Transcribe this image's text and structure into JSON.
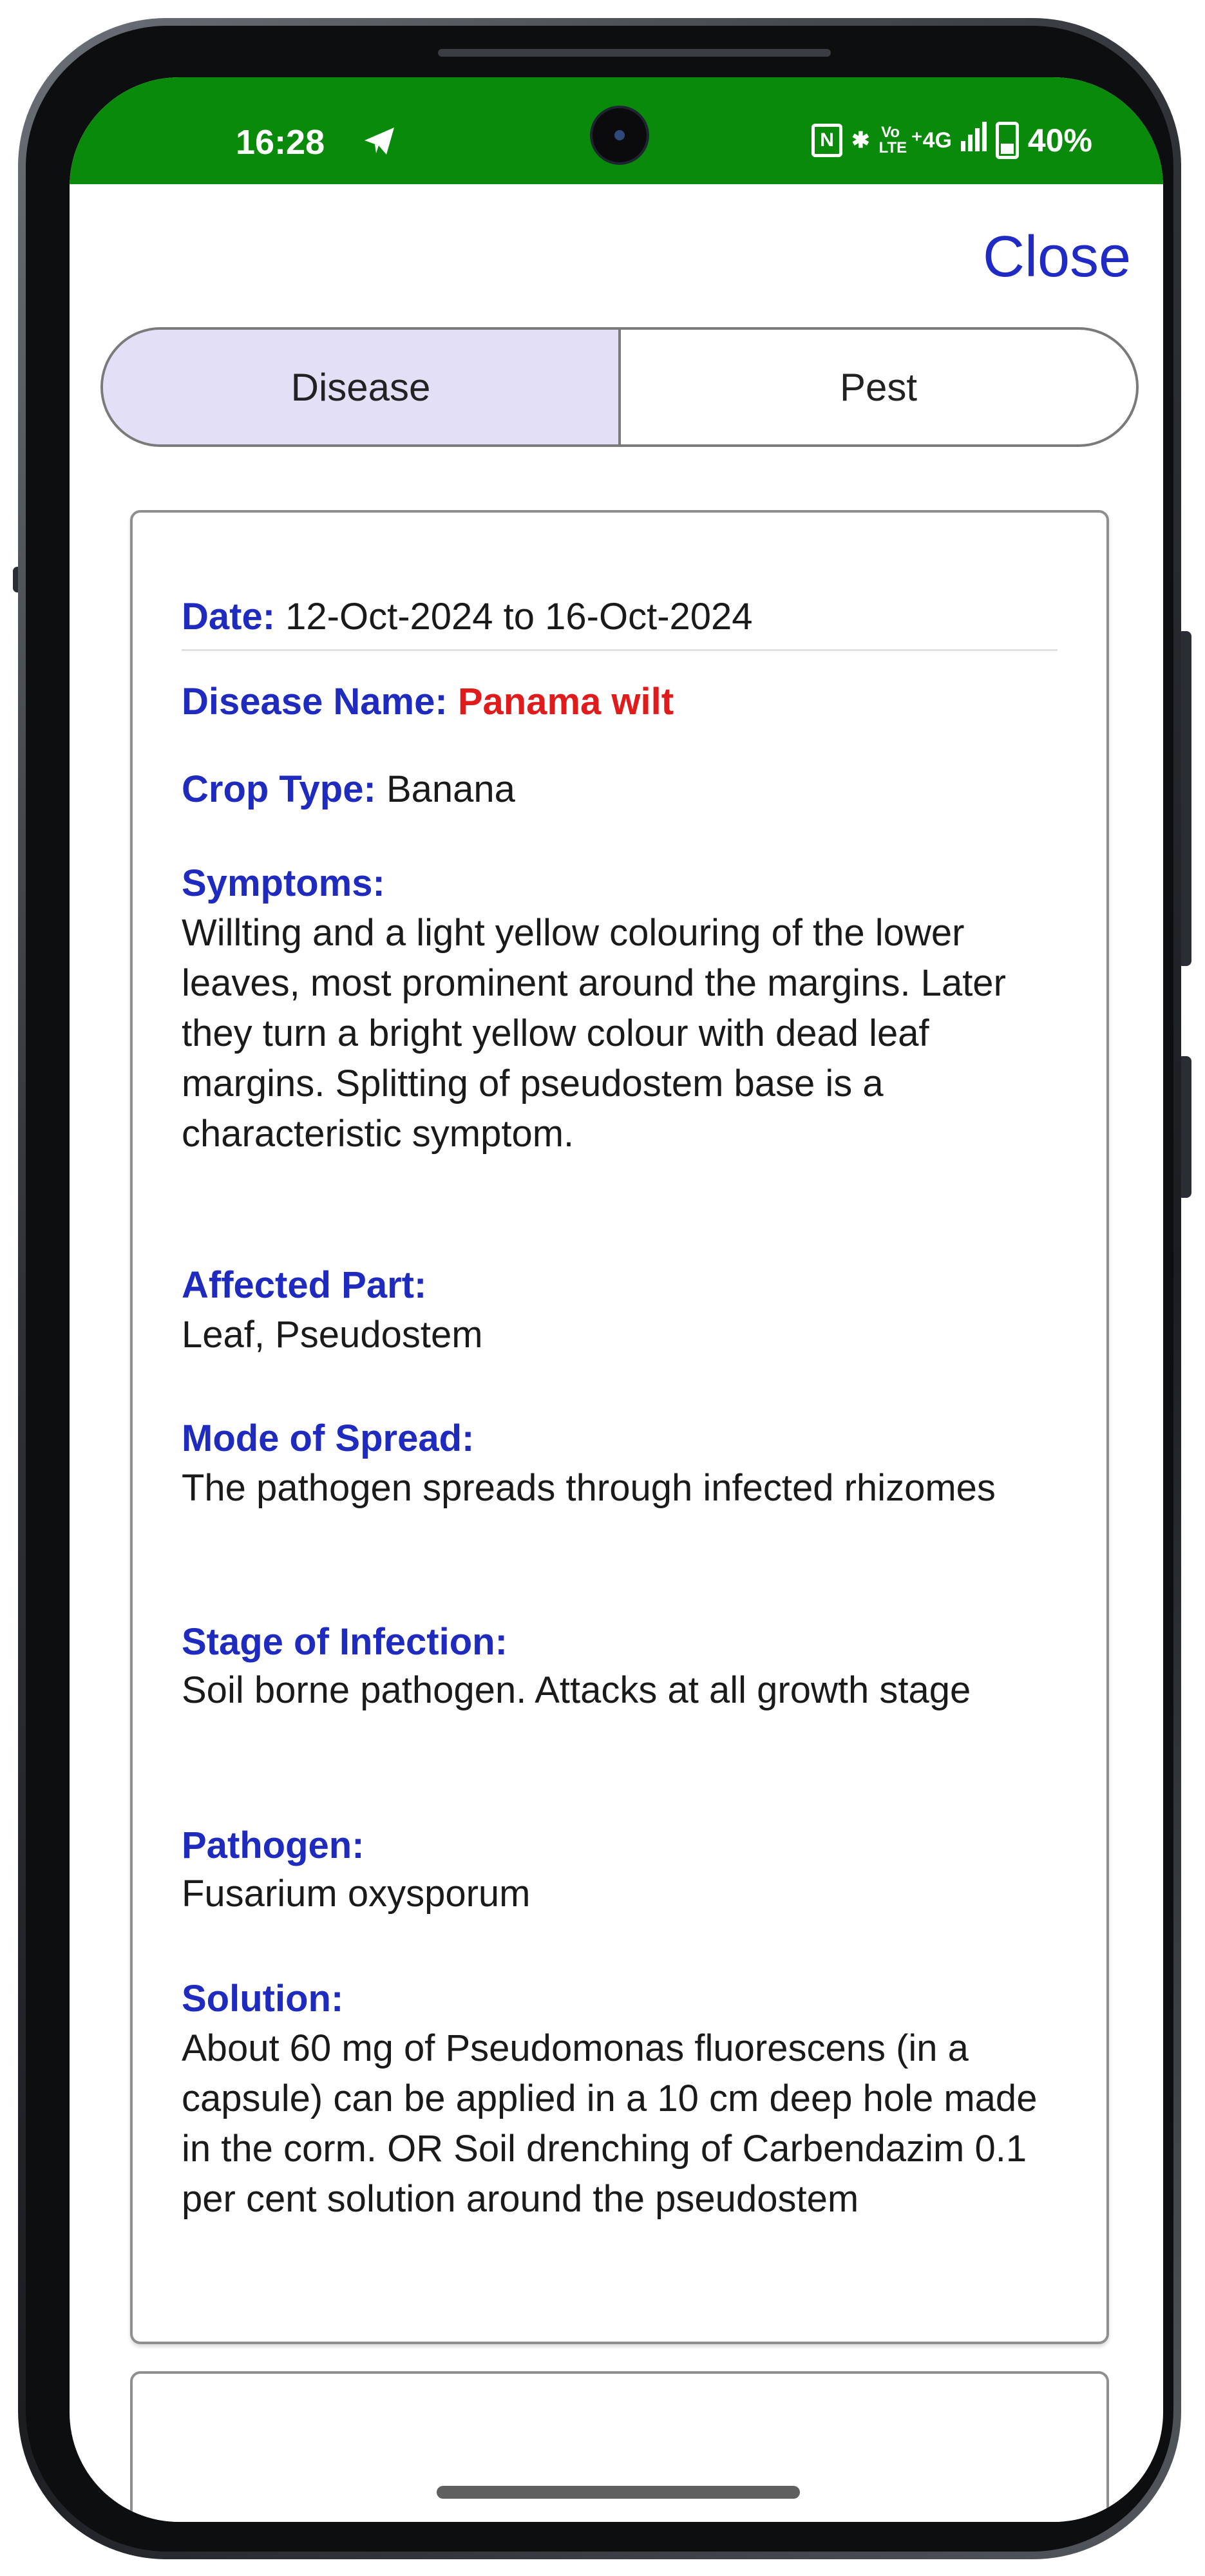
{
  "status_bar": {
    "time": "16:28",
    "telegram_icon": "telegram-send-icon",
    "nfc": "N",
    "bluetooth": "✱",
    "volte": "Vo LTE",
    "network": "⁺4G",
    "signal_icon": "signal-icon",
    "battery_icon": "battery-icon",
    "battery": "40%",
    "color": "#0a8a0a"
  },
  "header": {
    "close_label": "Close",
    "close_color": "#1f2bc4"
  },
  "tabs": [
    {
      "label": "Disease",
      "active": true
    },
    {
      "label": "Pest",
      "active": false
    }
  ],
  "record": {
    "date_label": "Date:",
    "date_value": "12-Oct-2024 to 16-Oct-2024",
    "disease_label": "Disease Name:",
    "disease_value": "Panama wilt",
    "crop_label": "Crop Type:",
    "crop_value": "Banana",
    "symptoms_label": "Symptoms:",
    "symptoms_value": "Willting and a light yellow colouring of the lower leaves, most prominent around the margins. Later they turn a bright yellow colour with dead leaf margins. Splitting of pseudostem base is a characteristic symptom.",
    "affected_label": "Affected Part:",
    "affected_value": "Leaf, Pseudostem",
    "spread_label": "Mode of Spread:",
    "spread_value": "The pathogen spreads through infected rhizomes",
    "stage_label": "Stage of Infection:",
    "stage_value": "Soil borne pathogen. Attacks at all growth stage",
    "pathogen_label": "Pathogen:",
    "pathogen_value": "Fusarium oxysporum",
    "solution_label": "Solution:",
    "solution_value": "About 60 mg of Pseudomonas fluorescens (in a capsule) can be applied in a 10 cm deep hole made in the corm. OR  Soil drenching of Carbendazim 0.1 per cent solution around the pseudostem"
  },
  "colors": {
    "label": "#1f2bbf",
    "disease_name": "#e01b1b",
    "tab_active_bg": "#e3dff7"
  }
}
